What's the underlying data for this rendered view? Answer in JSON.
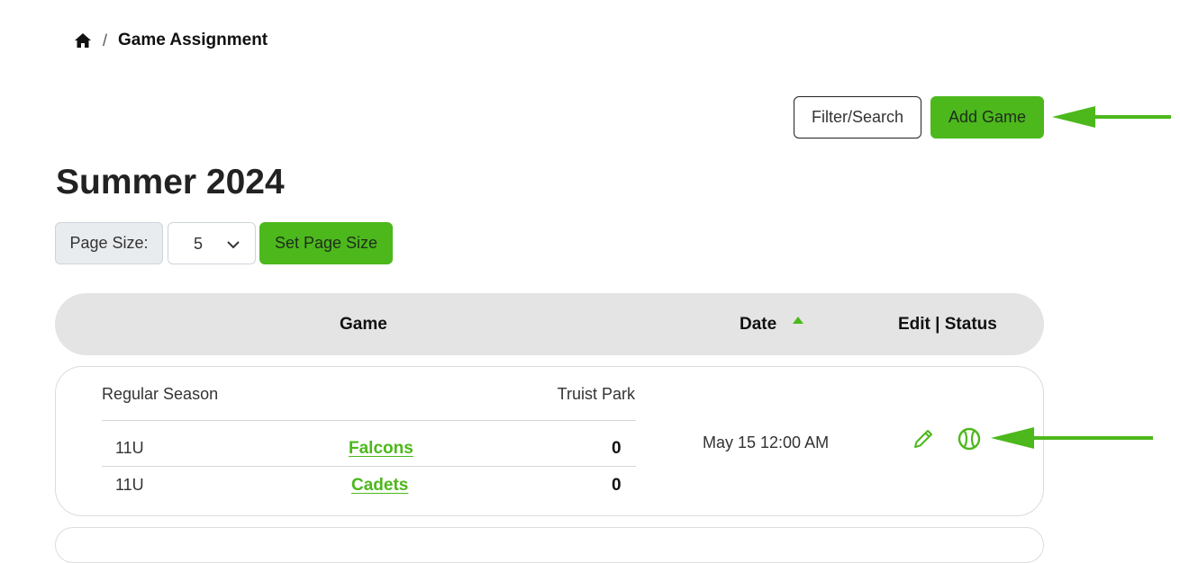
{
  "breadcrumb": {
    "icon": "home-icon",
    "separator": "/",
    "current": "Game Assignment"
  },
  "toolbar": {
    "filter_label": "Filter/Search",
    "add_label": "Add Game"
  },
  "season": {
    "title": "Summer 2024"
  },
  "page_size": {
    "label": "Page Size:",
    "value": "5",
    "set_label": "Set Page Size"
  },
  "table": {
    "columns": {
      "game": "Game",
      "date": "Date",
      "edit_status": "Edit | Status"
    },
    "sort": {
      "column": "Date",
      "direction": "ascending"
    },
    "rows": [
      {
        "type": "Regular Season",
        "venue": "Truist Park",
        "teams": [
          {
            "age": "11U",
            "name": "Falcons",
            "score": "0"
          },
          {
            "age": "11U",
            "name": "Cadets",
            "score": "0"
          }
        ],
        "date": "May 15 12:00 AM"
      }
    ]
  },
  "colors": {
    "accent": "#4cb81c",
    "header_bg": "#e4e4e4",
    "arrow": "#4cb81c"
  }
}
